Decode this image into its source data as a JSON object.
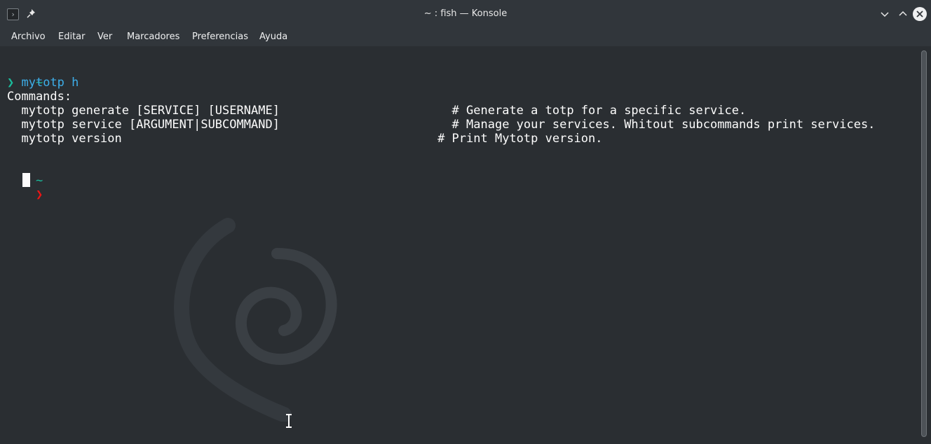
{
  "window": {
    "title": "~ : fish — Konsole",
    "app_icon_glyph": "›",
    "icons": [
      "terminal-icon",
      "pin-icon",
      "minimize-icon",
      "maximize-icon",
      "close-icon"
    ]
  },
  "menu": {
    "items": [
      "Archivo",
      "Editar",
      "Ver",
      "Marcadores",
      "Preferencias",
      "Ayuda"
    ]
  },
  "terminal": {
    "colors": {
      "background": "#2a2e32",
      "text": "#fcfcfc",
      "tilde": "#1abc9c",
      "command": "#3daee9",
      "error_prompt": "#ed1515"
    },
    "lines": [
      {
        "tilde": "~"
      },
      {
        "prompt": "❯",
        "command": "mytotp h"
      },
      {
        "text": "Commands:"
      },
      {
        "text": "  mytotp generate [SERVICE] [USERNAME]                        # Generate a totp for a specific service."
      },
      {
        "text": "  mytotp service [ARGUMENT|SUBCOMMAND]                        # Manage your services. Whitout subcommands print services."
      },
      {
        "text": "  mytotp version                                            # Print Mytotp version."
      },
      {
        "tilde": "~"
      },
      {
        "prompt": "❯"
      }
    ]
  }
}
